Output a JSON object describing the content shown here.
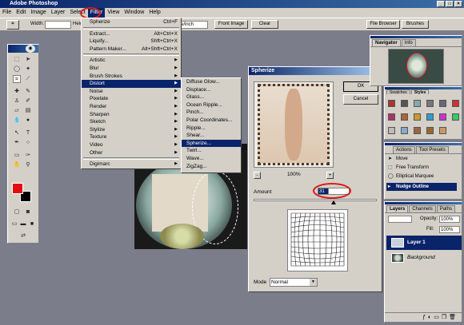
{
  "app": {
    "title": "Adobe Photoshop",
    "window_controls": [
      "_",
      "□",
      "×"
    ]
  },
  "menubar": {
    "items": [
      "File",
      "Edit",
      "Image",
      "Layer",
      "Select",
      "Filter",
      "View",
      "Window",
      "Help"
    ]
  },
  "options_bar": {
    "width_label": "Width:",
    "height_label": "Heig",
    "resolution_value": "e/inch",
    "front_image_label": "Front Image",
    "clear_label": "Clear",
    "file_browser_tab": "File Browser",
    "brushes_tab": "Brushes"
  },
  "filter_menu": {
    "top": [
      {
        "label": "Spherize",
        "shortcut": "Ctrl+F"
      }
    ],
    "mid": [
      {
        "label": "Extract...",
        "shortcut": "Alt+Ctrl+X"
      },
      {
        "label": "Liquify...",
        "shortcut": "Shft+Ctrl+X"
      },
      {
        "label": "Pattern Maker...",
        "shortcut": "Alt+Shft+Ctrl+X"
      }
    ],
    "submenus": [
      "Artistic",
      "Blur",
      "Brush Strokes",
      "Distort",
      "Noise",
      "Pixelate",
      "Render",
      "Sharpen",
      "Sketch",
      "Stylize",
      "Texture",
      "Video",
      "Other"
    ],
    "bottom": [
      "Digimarc"
    ]
  },
  "distort_menu": {
    "items": [
      "Diffuse Glow...",
      "Displace...",
      "Glass...",
      "Ocean Ripple...",
      "Pinch...",
      "Polar Coordinates...",
      "Ripple...",
      "Shear...",
      "Spherize...",
      "Twirl...",
      "Wave...",
      "ZigZag..."
    ],
    "selected": "Spherize..."
  },
  "spherize_dialog": {
    "title": "Spherize",
    "ok_label": "OK",
    "cancel_label": "Cancel",
    "zoom_minus": "-",
    "zoom_plus": "+",
    "zoom_value": "100%",
    "amount_label": "Amount",
    "amount_value": "31",
    "amount_fraction": 0.65,
    "mode_label": "Mode",
    "mode_value": "Normal"
  },
  "navigator": {
    "tabs": [
      "Navigator",
      "Info"
    ]
  },
  "styles_panel": {
    "tabs": [
      "Swatches",
      "Styles"
    ]
  },
  "history_panel": {
    "tabs": [
      "Actions",
      "Tool Presets"
    ],
    "items": [
      "Move",
      "Free Transform",
      "Elliptical Marquee",
      "Nudge Outline"
    ],
    "active": "Nudge Outline"
  },
  "layers_panel": {
    "tabs": [
      "Layers",
      "Channels",
      "Paths"
    ],
    "opacity_label": "Opacity:",
    "opacity_value": "100%",
    "fill_label": "Fill:",
    "fill_value": "100%",
    "layers": [
      "Layer 1",
      "Background"
    ]
  },
  "colors": {
    "foreground": "#e01010",
    "background": "#000000",
    "highlight": "#0a246a",
    "annotation": "#d81b1b"
  }
}
